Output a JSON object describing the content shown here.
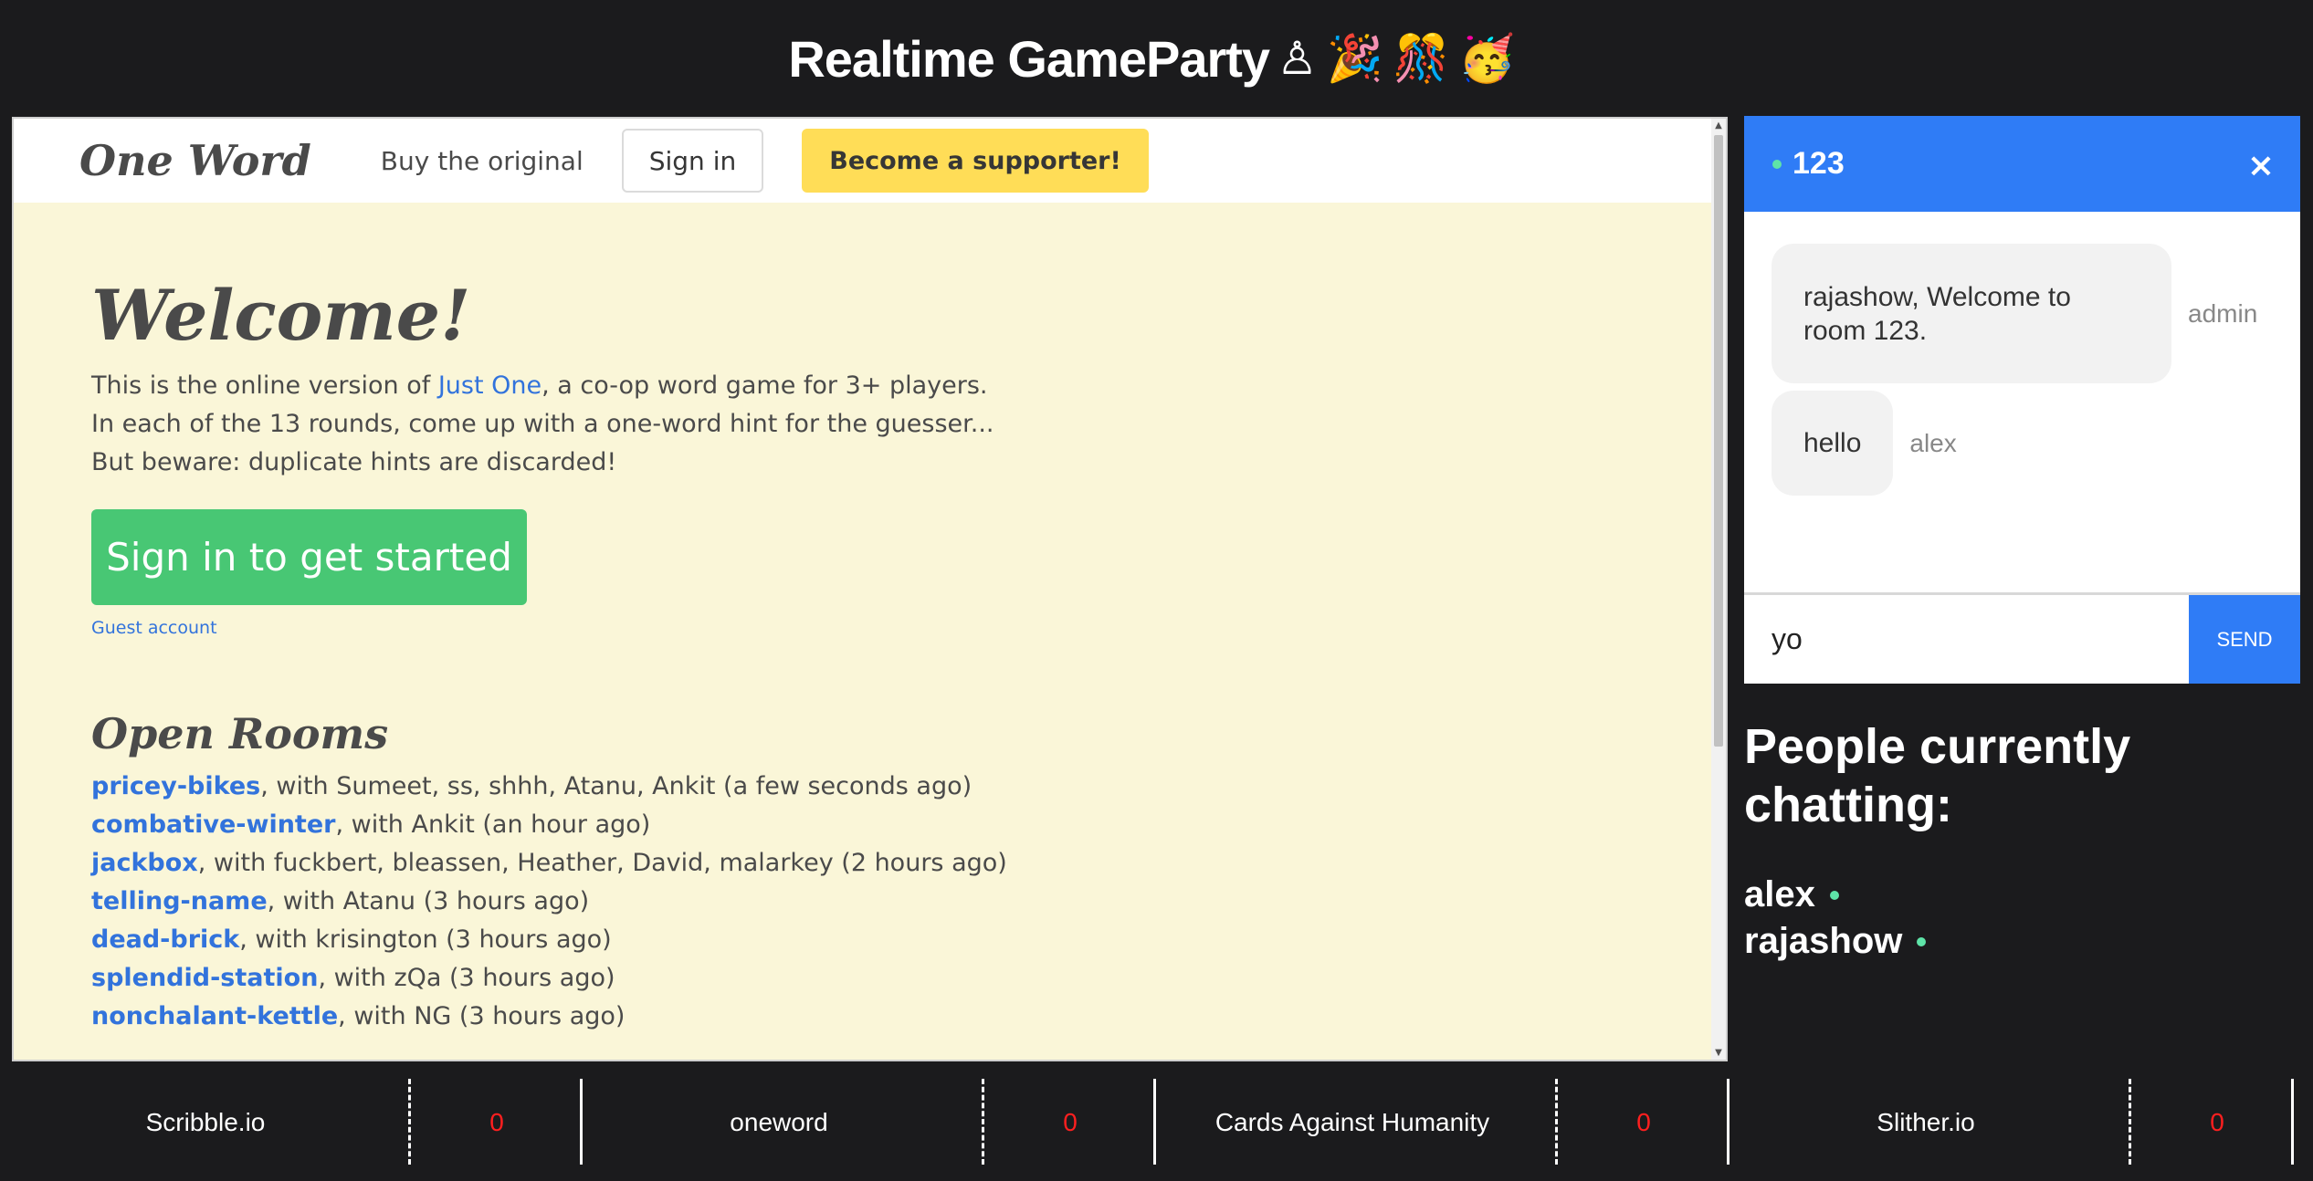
{
  "header": {
    "title": "Realtime GameParty",
    "emojis": "♙🎉🎊🥳"
  },
  "game": {
    "nav": {
      "brand": "One Word",
      "buy_link": "Buy the original",
      "signin": "Sign in",
      "supporter": "Become a supporter!"
    },
    "welcome": "Welcome!",
    "intro": {
      "line1_prefix": "This is the online version of ",
      "line1_link": "Just One",
      "line1_suffix": ", a co-op word game for 3+ players.",
      "line2": "In each of the 13 rounds, come up with a one-word hint for the guesser...",
      "line3": "But beware: duplicate hints are discarded!"
    },
    "start_button": "Sign in to get started",
    "guest_link": "Guest account",
    "rooms_title": "Open Rooms",
    "rooms": [
      {
        "name": "pricey-bikes",
        "detail": ", with Sumeet, ss, shhh, Atanu, Ankit (a few seconds ago)"
      },
      {
        "name": "combative-winter",
        "detail": ", with Ankit (an hour ago)"
      },
      {
        "name": "jackbox",
        "detail": ", with fuckbert, bleassen, Heather, David, malarkey (2 hours ago)"
      },
      {
        "name": "telling-name",
        "detail": ", with Atanu (3 hours ago)"
      },
      {
        "name": "dead-brick",
        "detail": ", with krisington (3 hours ago)"
      },
      {
        "name": "splendid-station",
        "detail": ", with zQa (3 hours ago)"
      },
      {
        "name": "nonchalant-kettle",
        "detail": ", with NG (3 hours ago)"
      }
    ]
  },
  "chat": {
    "room": "123",
    "close": "×",
    "messages": [
      {
        "text": "rajashow, Welcome to room 123.",
        "sender": "admin"
      },
      {
        "text": "hello",
        "sender": "alex"
      }
    ],
    "input_value": "yo",
    "send": "SEND"
  },
  "people": {
    "title": "People currently chatting:",
    "list": [
      "alex",
      "rajashow"
    ]
  },
  "games_bar": [
    {
      "name": "Scribble.io",
      "count": "0"
    },
    {
      "name": "oneword",
      "count": "0"
    },
    {
      "name": "Cards Against Humanity",
      "count": "0"
    },
    {
      "name": "Slither.io",
      "count": "0"
    }
  ],
  "colors": {
    "page_bg": "#1b1b1d",
    "chat_accent": "#2f7cf6",
    "online_dot": "#5ee4a8",
    "game_bg": "#faf6d8",
    "link": "#3273dc",
    "start_button": "#48c774",
    "supporter_button": "#ffdd57",
    "counter": "#ff1f1f"
  }
}
